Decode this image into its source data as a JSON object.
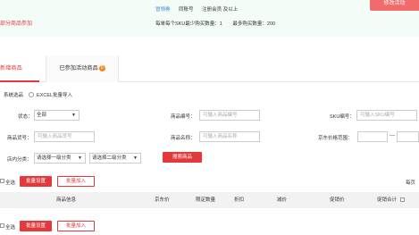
{
  "topbar": {
    "left_label": "部分商品参加",
    "line1": [
      "冒领券",
      "同账号",
      "注册会员 及以上"
    ],
    "line2": [
      "每单每个SKU最少购买数量：1",
      "最多购买数量：200"
    ],
    "button_label": "修改活动"
  },
  "tabs": [
    {
      "label": "新增商品",
      "active": true
    },
    {
      "label": "已参加活动商品",
      "badge": "0",
      "active": false
    }
  ],
  "selection": {
    "label": "系统选品",
    "radio_label": "EXCEL批量导入"
  },
  "filters": {
    "status": {
      "label": "状态：",
      "value": "全部"
    },
    "product_code": {
      "label": "商品编号：",
      "placeholder": "可输入商品编号"
    },
    "sku_code": {
      "label": "SKU编号：",
      "placeholder": "可输入SKU编号"
    },
    "product_item_no": {
      "label": "商品货号：",
      "placeholder": "可输入商品货号"
    },
    "product_name": {
      "label": "商品名称：",
      "placeholder": "可输入商品名称"
    },
    "jd_price_range": {
      "label": "京东价格范围：",
      "separator": "—"
    },
    "category": {
      "label": "店内分类：",
      "level1": "请选择一级分类",
      "level2": "请选择二级分类"
    },
    "search_button": "搜索商品"
  },
  "batch": {
    "select_all": "全选",
    "batch_settings": "批量设置",
    "batch_add": "批量加入",
    "per_page": "每页"
  },
  "table": {
    "headers": [
      "商品信息",
      "京东价",
      "限定数量",
      "折扣",
      "减价",
      "促销价",
      "促销合计"
    ]
  },
  "colors": {
    "accent": "#e4393c",
    "top_bg": "#f3fcf7",
    "badge": "#f08a24",
    "link": "#3a7bd5"
  }
}
